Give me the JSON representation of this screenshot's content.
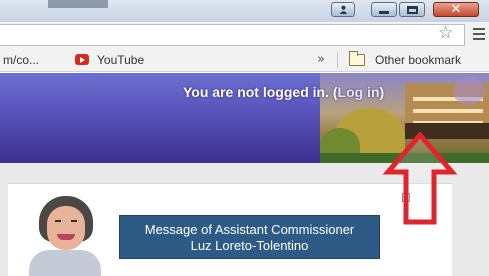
{
  "browser": {
    "address_value": "",
    "bookmarks": {
      "first_label": "m/co...",
      "youtube_label": "YouTube",
      "overflow_label": "»",
      "other_label": "Other bookmark"
    }
  },
  "banner": {
    "prefix": "You are not logged in. (",
    "login_link": "Log in",
    "suffix": ")"
  },
  "message": {
    "line1": "Message of Assistant Commissioner",
    "line2": "Luz Loreto-Tolentino"
  },
  "annotation": {
    "arrow_color": "#e0242b"
  },
  "colors": {
    "banner": "#5a55bd",
    "message_box": "#2d5b86",
    "window_close": "#c24a2f"
  },
  "icons": [
    "user-icon",
    "minimize-icon",
    "maximize-icon",
    "close-icon",
    "star-icon",
    "menu-icon",
    "youtube-icon",
    "folder-icon"
  ]
}
